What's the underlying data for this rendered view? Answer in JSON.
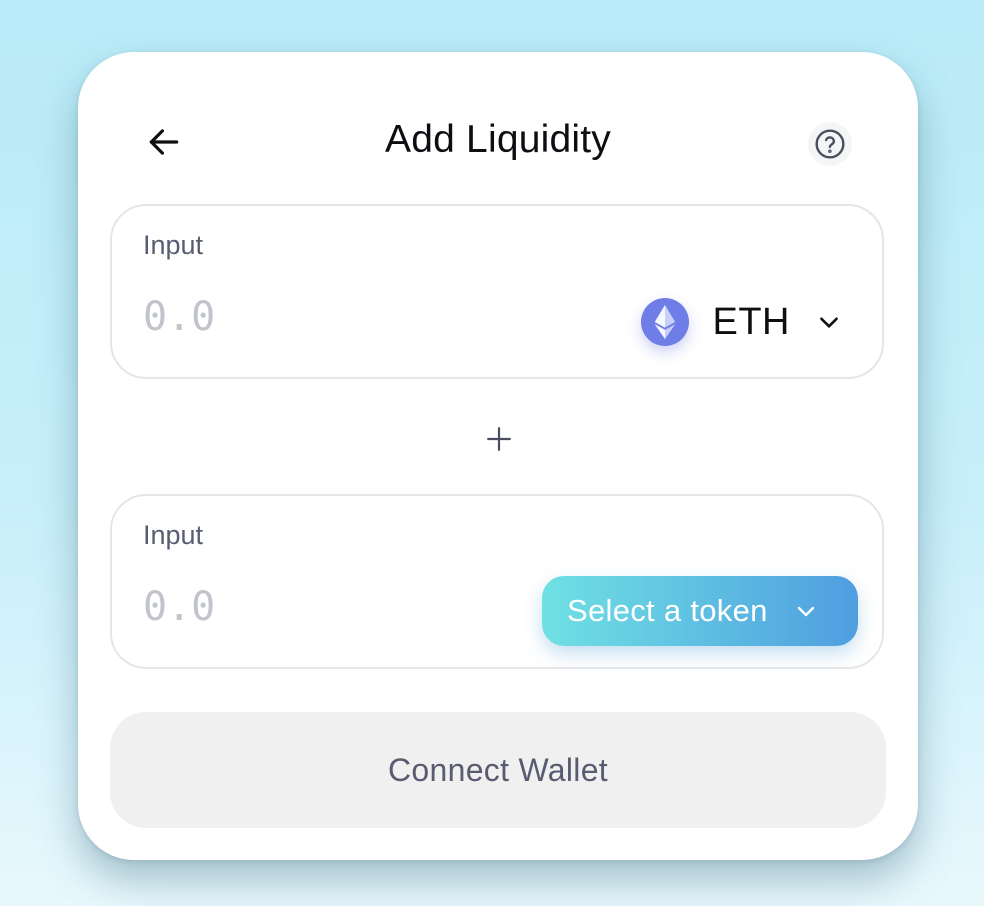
{
  "header": {
    "title": "Add Liquidity",
    "back_icon": "arrow-left-icon",
    "help_icon": "question-circle-icon"
  },
  "input_a": {
    "label": "Input",
    "placeholder": "0.0",
    "token": {
      "symbol": "ETH",
      "icon": "ethereum-icon",
      "chevron_icon": "chevron-down-icon"
    }
  },
  "separator": {
    "icon": "plus-icon"
  },
  "input_b": {
    "label": "Input",
    "placeholder": "0.0",
    "select_button_label": "Select a token",
    "chevron_icon": "chevron-down-icon"
  },
  "connect_button": {
    "label": "Connect Wallet"
  },
  "colors": {
    "select_gradient_start": "#6fe1e3",
    "select_gradient_end": "#4f9ee0",
    "eth_logo": "#6f7ee6",
    "connect_bg": "#f0f0f0",
    "connect_text": "#595c70"
  }
}
